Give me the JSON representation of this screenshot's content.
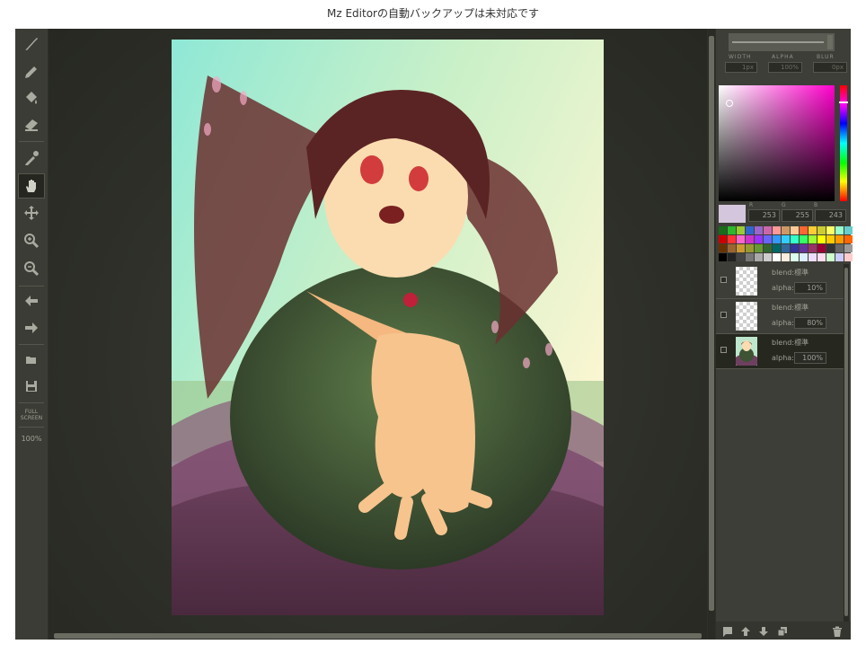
{
  "notice": "Mz Editorの自動バックアップは未対応です",
  "toolbar": {
    "tools": [
      {
        "name": "brush-icon",
        "active": false
      },
      {
        "name": "pencil-icon",
        "active": false
      },
      {
        "name": "bucket-icon",
        "active": false
      },
      {
        "name": "eraser-icon",
        "active": false
      },
      {
        "name": "eyedropper-icon",
        "active": false
      },
      {
        "name": "hand-icon",
        "active": true
      },
      {
        "name": "move-icon",
        "active": false
      },
      {
        "name": "zoom-in-icon",
        "active": false
      },
      {
        "name": "zoom-out-icon",
        "active": false
      },
      {
        "name": "undo-arrow-icon",
        "active": false
      },
      {
        "name": "redo-arrow-icon",
        "active": false
      },
      {
        "name": "open-folder-icon",
        "active": false
      },
      {
        "name": "save-icon",
        "active": false
      }
    ],
    "fullscreen_line1": "FULL",
    "fullscreen_line2": "SCREEN",
    "zoom": "100%"
  },
  "brush": {
    "width_label": "WIDTH",
    "alpha_label": "ALPHA",
    "blur_label": "BLUR",
    "width_value": "1px",
    "alpha_value": "100%",
    "blur_value": "0px"
  },
  "color": {
    "current": "#fdffF3",
    "r_label": "R",
    "g_label": "G",
    "b_label": "B",
    "r": "253",
    "g": "255",
    "b": "243",
    "swatch_display": "#d4c6dc"
  },
  "palette": [
    "#1a6b1a",
    "#2db82d",
    "#99cc33",
    "#3366cc",
    "#9966cc",
    "#cc66aa",
    "#ff9999",
    "#cc9966",
    "#ffcc99",
    "#ff6633",
    "#ffcc33",
    "#cccc33",
    "#ffff66",
    "#99ffcc",
    "#66cccc",
    "#cc0000",
    "#ff3333",
    "#ff66cc",
    "#cc33cc",
    "#9933ff",
    "#6666ff",
    "#3399ff",
    "#33ccff",
    "#33ffcc",
    "#33ff66",
    "#99ff33",
    "#ffff00",
    "#ffcc00",
    "#ff9900",
    "#ff6600",
    "#663300",
    "#996633",
    "#cc9933",
    "#999933",
    "#669933",
    "#336633",
    "#006666",
    "#336699",
    "#333399",
    "#663399",
    "#993366",
    "#990033",
    "#333333",
    "#666666",
    "#999999",
    "#000000",
    "#222222",
    "#444444",
    "#777777",
    "#aaaaaa",
    "#cccccc",
    "#ffffff",
    "#ffeedd",
    "#ddffee",
    "#ddeeff",
    "#eeddff",
    "#ffddee",
    "#ccffcc",
    "#ccccff",
    "#ffcccc"
  ],
  "layers": [
    {
      "blend_label": "blend:",
      "blend_mode": "標準",
      "alpha_label": "alpha:",
      "alpha": "10%",
      "selected": false
    },
    {
      "blend_label": "blend:",
      "blend_mode": "標準",
      "alpha_label": "alpha:",
      "alpha": "80%",
      "selected": false
    },
    {
      "blend_label": "blend:",
      "blend_mode": "標準",
      "alpha_label": "alpha:",
      "alpha": "100%",
      "selected": true
    }
  ],
  "layer_tools": [
    "new-layer-icon",
    "move-layer-up-icon",
    "move-layer-down-icon",
    "duplicate-layer-icon",
    "trash-icon"
  ]
}
